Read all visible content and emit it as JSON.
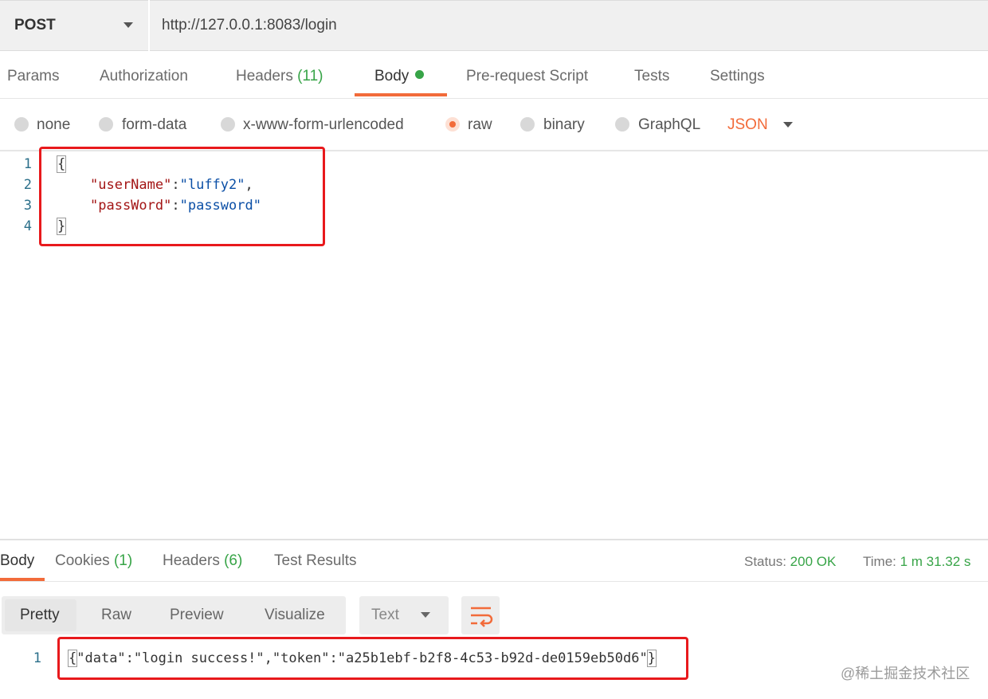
{
  "request": {
    "method": "POST",
    "url": "http://127.0.0.1:8083/login"
  },
  "request_tabs": {
    "params": "Params",
    "authorization": "Authorization",
    "headers": "Headers",
    "headers_count": "(11)",
    "body": "Body",
    "prerequest": "Pre-request Script",
    "tests": "Tests",
    "settings": "Settings"
  },
  "body_types": {
    "none": "none",
    "form_data": "form-data",
    "urlencoded": "x-www-form-urlencoded",
    "raw": "raw",
    "binary": "binary",
    "graphql": "GraphQL",
    "format": "JSON",
    "selected": "raw"
  },
  "editor": {
    "line_numbers": [
      "1",
      "2",
      "3",
      "4"
    ],
    "open_brace": "{",
    "key1": "\"userName\"",
    "val1": "\"luffy2\"",
    "key2": "\"passWord\"",
    "val2": "\"password\"",
    "colon": ":",
    "comma": ",",
    "close_brace": "}"
  },
  "response_tabs": {
    "body": "Body",
    "cookies": "Cookies",
    "cookies_count": "(1)",
    "headers": "Headers",
    "headers_count": "(6)",
    "test_results": "Test Results"
  },
  "response_status": {
    "status_label": "Status:",
    "status_value": "200 OK",
    "time_label": "Time:",
    "time_value": "1 m 31.32 s"
  },
  "response_view": {
    "pretty": "Pretty",
    "raw": "Raw",
    "preview": "Preview",
    "visualize": "Visualize",
    "format": "Text"
  },
  "response_body": {
    "line_number": "1",
    "open_brace": "{",
    "content": "\"data\":\"login success!\",\"token\":\"a25b1ebf-b2f8-4c53-b92d-de0159eb50d6\"",
    "close_brace": "}"
  },
  "watermark": "@稀土掘金技术社区",
  "colors": {
    "accent": "#f26b3a",
    "success": "#37a447",
    "highlight_box": "#e8191c"
  }
}
